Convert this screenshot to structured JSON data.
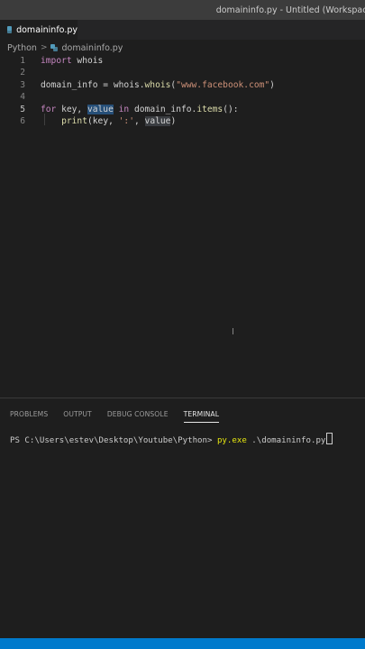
{
  "window": {
    "title": "domaininfo.py - Untitled (Workspace)"
  },
  "tab": {
    "label": "domaininfo.py",
    "close": "×"
  },
  "breadcrumb": {
    "items": [
      "Python",
      "domaininfo.py"
    ]
  },
  "editor": {
    "active_line": 5,
    "lines": [
      {
        "number": "1",
        "parts": [
          {
            "t": "import",
            "c": "kw"
          },
          {
            "t": " whois",
            "c": "var"
          }
        ]
      },
      {
        "number": "2",
        "parts": []
      },
      {
        "number": "3",
        "parts": [
          {
            "t": "domain_info = whois.",
            "c": "var"
          },
          {
            "t": "whois",
            "c": "fn"
          },
          {
            "t": "(",
            "c": "var"
          },
          {
            "t": "\"www.facebook.com\"",
            "c": "str"
          },
          {
            "t": ")",
            "c": "var"
          }
        ]
      },
      {
        "number": "4",
        "parts": []
      },
      {
        "number": "5",
        "parts": [
          {
            "t": "for",
            "c": "kw"
          },
          {
            "t": " key, ",
            "c": "var"
          },
          {
            "t": "value",
            "c": "var hl"
          },
          {
            "t": " ",
            "c": "var"
          },
          {
            "t": "in",
            "c": "kw"
          },
          {
            "t": " domain_info.",
            "c": "var"
          },
          {
            "t": "items",
            "c": "fn"
          },
          {
            "t": "():",
            "c": "var"
          }
        ]
      },
      {
        "number": "6",
        "parts": [
          {
            "t": "    ",
            "c": "var"
          },
          {
            "t": "print",
            "c": "fn"
          },
          {
            "t": "(key, ",
            "c": "var"
          },
          {
            "t": "':'",
            "c": "str"
          },
          {
            "t": ", ",
            "c": "var"
          },
          {
            "t": "value",
            "c": "var hl2"
          },
          {
            "t": ")",
            "c": "var"
          }
        ]
      }
    ]
  },
  "panel": {
    "tabs": [
      "PROBLEMS",
      "OUTPUT",
      "DEBUG CONSOLE",
      "TERMINAL"
    ],
    "active_tab": "TERMINAL"
  },
  "terminal": {
    "prompt": "PS C:\\Users\\estev\\Desktop\\Youtube\\Python> ",
    "command": "py.exe",
    "args": " .\\domaininfo.py"
  },
  "colors": {
    "statusbar": "#007acc",
    "keyword": "#c586c0",
    "string": "#ce9178",
    "function": "#dcdcaa"
  }
}
